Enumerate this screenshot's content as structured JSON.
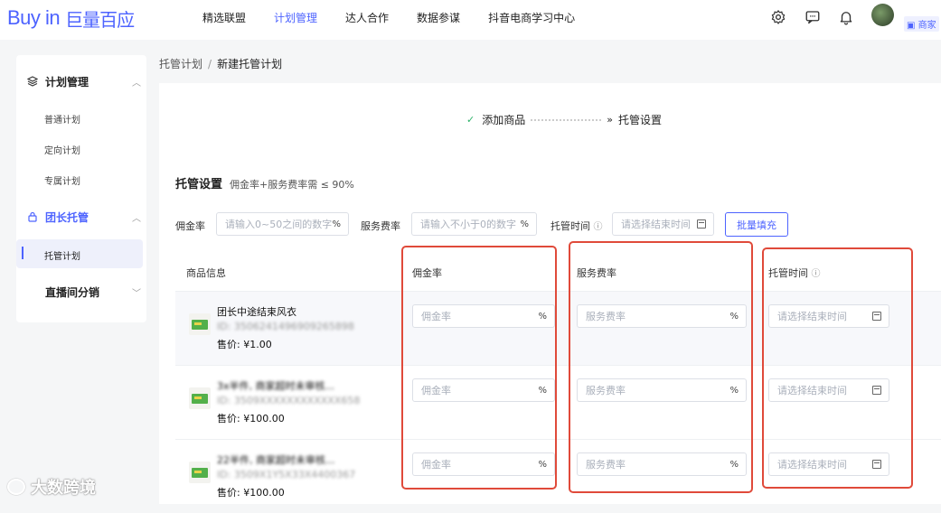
{
  "header": {
    "logo_en": "Buy in",
    "logo_cn": "巨量百应",
    "nav": [
      "精选联盟",
      "计划管理",
      "达人合作",
      "数据参谋",
      "抖音电商学习中心"
    ],
    "active_nav": "计划管理",
    "icons": [
      "gear-icon",
      "chat-icon",
      "bell-icon"
    ],
    "user": {
      "name": "",
      "role": "商家"
    }
  },
  "sidebar": {
    "plan_mgmt": "计划管理",
    "plan_items": [
      "普通计划",
      "定向计划",
      "专属计划"
    ],
    "group_mgmt": "团长托管",
    "group_items": [
      "托管计划"
    ],
    "live": "直播间分销"
  },
  "breadcrumb": {
    "parent": "托管计划",
    "separator": "/",
    "current": "新建托管计划"
  },
  "steps": {
    "step1": "添加商品",
    "step2": "托管设置"
  },
  "settings": {
    "title": "托管设置",
    "hint": "佣金率+服务费率需 ≤ 90%",
    "commission_label": "佣金率",
    "commission_placeholder": "请输入0~50之间的数字",
    "service_label": "服务费率",
    "service_placeholder": "请输入不小于0的数字",
    "time_label": "托管时间",
    "time_placeholder": "请选择结束时间",
    "percent": "%",
    "bulk_fill": "批量填充"
  },
  "table": {
    "headers": {
      "product": "商品信息",
      "commission": "佣金率",
      "service": "服务费率",
      "time": "托管时间"
    },
    "row_commission_placeholder": "佣金率",
    "row_service_placeholder": "服务费率",
    "row_time_placeholder": "请选择结束时间",
    "rows": [
      {
        "name": "团长中途结束风衣",
        "id": "ID: 3506241496909265898",
        "price": "售价: ¥1.00"
      },
      {
        "name": "3x半件, 商家超时未审核...",
        "id": "ID: 3509XXXXXXXXXXXX658",
        "price": "售价: ¥100.00"
      },
      {
        "name": "22半件, 商家超时未审核...",
        "id": "ID: 3509X1Y5X33X4400367",
        "price": "售价: ¥100.00"
      }
    ]
  },
  "watermark": "大数跨境"
}
